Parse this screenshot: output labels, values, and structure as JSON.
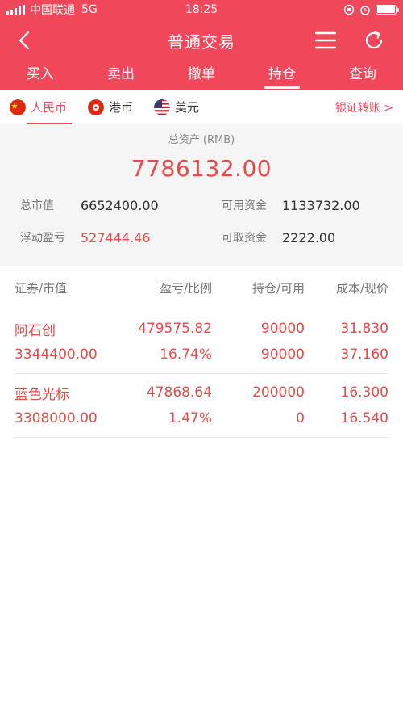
{
  "status": {
    "carrier": "中国联通",
    "network": "5G",
    "time": "18:25"
  },
  "nav": {
    "title": "普通交易"
  },
  "tabs": [
    {
      "label": "买入"
    },
    {
      "label": "卖出"
    },
    {
      "label": "撤单"
    },
    {
      "label": "持仓"
    },
    {
      "label": "查询"
    }
  ],
  "active_tab": "持仓",
  "currencies": [
    {
      "label": "人民币",
      "flag": "cn-flag-icon"
    },
    {
      "label": "港币",
      "flag": "hk-flag-icon"
    },
    {
      "label": "美元",
      "flag": "us-flag-icon"
    }
  ],
  "active_currency": "人民币",
  "transfer_link": "银证转账 >",
  "summary": {
    "total_label": "总资产 (RMB)",
    "total_value": "7786132.00",
    "market_value_label": "总市值",
    "market_value": "6652400.00",
    "available_label": "可用资金",
    "available": "1133732.00",
    "float_pl_label": "浮动盈亏",
    "float_pl": "527444.46",
    "withdrawable_label": "可取资金",
    "withdrawable": "2222.00"
  },
  "table": {
    "headers": [
      "证券/市值",
      "盈亏/比例",
      "持仓/可用",
      "成本/现价"
    ],
    "rows": [
      {
        "name": "阿石创",
        "market_value": "3344400.00",
        "profit": "479575.82",
        "ratio": "16.74%",
        "position": "90000",
        "available": "90000",
        "cost": "31.830",
        "price": "37.160"
      },
      {
        "name": "蓝色光标",
        "market_value": "3308000.00",
        "profit": "47868.64",
        "ratio": "1.47%",
        "position": "200000",
        "available": "0",
        "cost": "16.300",
        "price": "16.540"
      }
    ]
  },
  "colors": {
    "brand": "#f0475a",
    "value_red": "#e84a4a",
    "summary_bg": "#f5f5f5"
  }
}
